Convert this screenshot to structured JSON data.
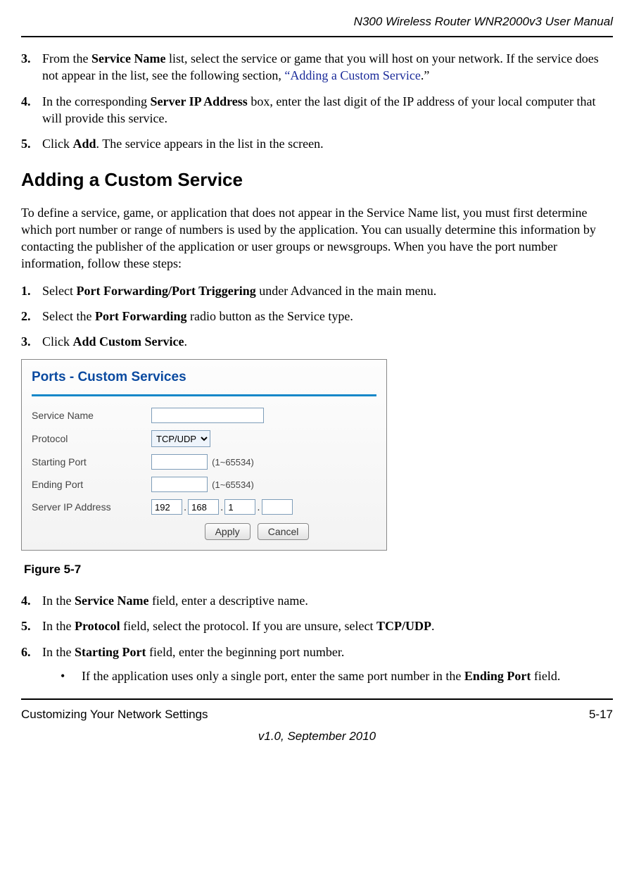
{
  "header": {
    "title": "N300 Wireless Router WNR2000v3 User Manual"
  },
  "top_steps": [
    {
      "num": "3.",
      "parts": [
        {
          "t": "From the "
        },
        {
          "b": "Service Name"
        },
        {
          "t": " list, select the service or game that you will host on your network. If the service does not appear in the list, see the following section, "
        },
        {
          "link_open": "“Adding a Custom Service"
        },
        {
          "t": ".”"
        }
      ]
    },
    {
      "num": "4.",
      "parts": [
        {
          "t": "In the corresponding "
        },
        {
          "b": "Server IP Address"
        },
        {
          "t": " box, enter the last digit of the IP address of your local computer that will provide this service."
        }
      ]
    },
    {
      "num": "5.",
      "parts": [
        {
          "t": "Click "
        },
        {
          "b": "Add"
        },
        {
          "t": ". The service appears in the list in the screen."
        }
      ]
    }
  ],
  "section_title": "Adding a Custom Service",
  "intro": "To define a service, game, or application that does not appear in the Service Name list, you must first determine which port number or range of numbers is used by the application. You can usually determine this information by contacting the publisher of the application or user groups or newsgroups. When you have the port number information, follow these steps:",
  "mid_steps": [
    {
      "num": "1.",
      "parts": [
        {
          "t": "Select "
        },
        {
          "b": "Port Forwarding/Port Triggering"
        },
        {
          "t": " under Advanced in the main menu."
        }
      ]
    },
    {
      "num": "2.",
      "parts": [
        {
          "t": "Select the "
        },
        {
          "b": "Port Forwarding"
        },
        {
          "t": " radio button as the Service type."
        }
      ]
    },
    {
      "num": "3.",
      "parts": [
        {
          "t": "Click "
        },
        {
          "b": "Add Custom Service"
        },
        {
          "t": "."
        }
      ]
    }
  ],
  "figure": {
    "title": "Ports - Custom Services",
    "labels": {
      "service_name": "Service Name",
      "protocol": "Protocol",
      "starting_port": "Starting Port",
      "ending_port": "Ending Port",
      "server_ip": "Server IP Address"
    },
    "values": {
      "protocol": "TCP/UDP",
      "port_hint": "(1~65534)",
      "ip1": "192",
      "ip2": "168",
      "ip3": "1",
      "ip4": "",
      "service_name_value": "",
      "starting_port_value": "",
      "ending_port_value": ""
    },
    "buttons": {
      "apply": "Apply",
      "cancel": "Cancel"
    },
    "caption": "Figure 5-7"
  },
  "bottom_steps": [
    {
      "num": "4.",
      "parts": [
        {
          "t": "In the "
        },
        {
          "b": "Service Name"
        },
        {
          "t": " field, enter a descriptive name."
        }
      ]
    },
    {
      "num": "5.",
      "parts": [
        {
          "t": "In the "
        },
        {
          "b": "Protocol"
        },
        {
          "t": " field, select the protocol. If you are unsure, select "
        },
        {
          "b": "TCP/UDP"
        },
        {
          "t": "."
        }
      ]
    },
    {
      "num": "6.",
      "parts": [
        {
          "t": "In the "
        },
        {
          "b": "Starting Port"
        },
        {
          "t": " field, enter the beginning port number."
        }
      ],
      "bullets": [
        {
          "marker": "•",
          "parts": [
            {
              "t": "If the application uses only a single port, enter the same port number in the "
            },
            {
              "b": "Ending Port"
            },
            {
              "t": " field."
            }
          ]
        }
      ]
    }
  ],
  "footer": {
    "left": "Customizing Your Network Settings",
    "right": "5-17",
    "version": "v1.0, September 2010"
  }
}
